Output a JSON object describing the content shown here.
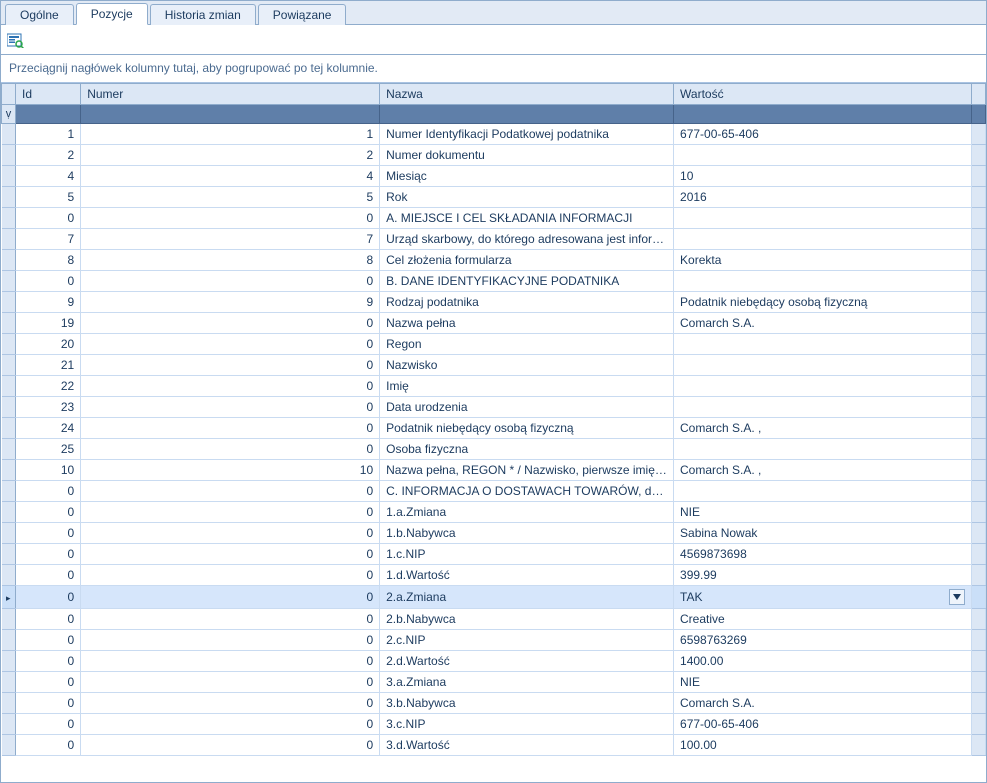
{
  "tabs": [
    {
      "label": "Ogólne",
      "active": false
    },
    {
      "label": "Pozycje",
      "active": true
    },
    {
      "label": "Historia zmian",
      "active": false
    },
    {
      "label": "Powiązane",
      "active": false
    }
  ],
  "group_hint": "Przeciągnij nagłówek kolumny tutaj, aby pogrupować po tej kolumnie.",
  "filter_icon": "ṿ",
  "columns": {
    "id": "Id",
    "numer": "Numer",
    "nazwa": "Nazwa",
    "wartosc": "Wartość"
  },
  "selected_index": 22,
  "rows": [
    {
      "id": "1",
      "numer": "1",
      "nazwa": "Numer Identyfikacji Podatkowej podatnika",
      "wartosc": "677-00-65-406"
    },
    {
      "id": "2",
      "numer": "2",
      "nazwa": "Numer dokumentu",
      "wartosc": ""
    },
    {
      "id": "4",
      "numer": "4",
      "nazwa": "Miesiąc",
      "wartosc": "10"
    },
    {
      "id": "5",
      "numer": "5",
      "nazwa": "Rok",
      "wartosc": "2016"
    },
    {
      "id": "0",
      "numer": "0",
      "nazwa": "A. MIEJSCE I CEL SKŁADANIA INFORMACJI",
      "wartosc": ""
    },
    {
      "id": "7",
      "numer": "7",
      "nazwa": "Urząd skarbowy, do którego adresowana jest informa...",
      "wartosc": ""
    },
    {
      "id": "8",
      "numer": "8",
      "nazwa": "Cel złożenia formularza",
      "wartosc": "Korekta"
    },
    {
      "id": "0",
      "numer": "0",
      "nazwa": "B. DANE IDENTYFIKACYJNE PODATNIKA",
      "wartosc": ""
    },
    {
      "id": "9",
      "numer": "9",
      "nazwa": "Rodzaj podatnika",
      "wartosc": "Podatnik niebędący osobą fizyczną"
    },
    {
      "id": "19",
      "numer": "0",
      "nazwa": "Nazwa pełna",
      "wartosc": "Comarch S.A."
    },
    {
      "id": "20",
      "numer": "0",
      "nazwa": "Regon",
      "wartosc": ""
    },
    {
      "id": "21",
      "numer": "0",
      "nazwa": "Nazwisko",
      "wartosc": ""
    },
    {
      "id": "22",
      "numer": "0",
      "nazwa": "Imię",
      "wartosc": ""
    },
    {
      "id": "23",
      "numer": "0",
      "nazwa": "Data urodzenia",
      "wartosc": ""
    },
    {
      "id": "24",
      "numer": "0",
      "nazwa": "Podatnik niebędący osobą fizyczną",
      "wartosc": "Comarch S.A. ,"
    },
    {
      "id": "25",
      "numer": "0",
      "nazwa": "Osoba fizyczna",
      "wartosc": ""
    },
    {
      "id": "10",
      "numer": "10",
      "nazwa": "Nazwa pełna, REGON * / Nazwisko, pierwsze imię, dat...",
      "wartosc": "Comarch S.A. ,"
    },
    {
      "id": "0",
      "numer": "0",
      "nazwa": "C. INFORMACJA O DOSTAWACH TOWARÓW, do który...",
      "wartosc": ""
    },
    {
      "id": "0",
      "numer": "0",
      "nazwa": "1.a.Zmiana",
      "wartosc": "NIE"
    },
    {
      "id": "0",
      "numer": "0",
      "nazwa": "1.b.Nabywca",
      "wartosc": "Sabina Nowak"
    },
    {
      "id": "0",
      "numer": "0",
      "nazwa": "1.c.NIP",
      "wartosc": "4569873698"
    },
    {
      "id": "0",
      "numer": "0",
      "nazwa": "1.d.Wartość",
      "wartosc": "399.99"
    },
    {
      "id": "0",
      "numer": "0",
      "nazwa": "2.a.Zmiana",
      "wartosc": "TAK"
    },
    {
      "id": "0",
      "numer": "0",
      "nazwa": "2.b.Nabywca",
      "wartosc": "Creative"
    },
    {
      "id": "0",
      "numer": "0",
      "nazwa": "2.c.NIP",
      "wartosc": "6598763269"
    },
    {
      "id": "0",
      "numer": "0",
      "nazwa": "2.d.Wartość",
      "wartosc": "1400.00"
    },
    {
      "id": "0",
      "numer": "0",
      "nazwa": "3.a.Zmiana",
      "wartosc": "NIE"
    },
    {
      "id": "0",
      "numer": "0",
      "nazwa": "3.b.Nabywca",
      "wartosc": "Comarch S.A."
    },
    {
      "id": "0",
      "numer": "0",
      "nazwa": "3.c.NIP",
      "wartosc": "677-00-65-406"
    },
    {
      "id": "0",
      "numer": "0",
      "nazwa": "3.d.Wartość",
      "wartosc": "100.00"
    }
  ]
}
